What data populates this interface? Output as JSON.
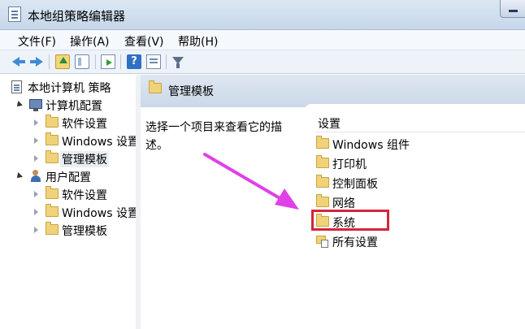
{
  "window": {
    "title": "本地组策略编辑器"
  },
  "menu": [
    {
      "label": "文件(F)"
    },
    {
      "label": "操作(A)"
    },
    {
      "label": "查看(V)"
    },
    {
      "label": "帮助(H)"
    }
  ],
  "toolbar": {
    "icons": [
      "back-icon",
      "forward-icon",
      "up-folder-icon",
      "show-hide-pane-icon",
      "export-list-icon",
      "help-icon",
      "properties-icon",
      "filter-icon"
    ]
  },
  "tree": {
    "root": "本地计算机 策略",
    "computer_config": "计算机配置",
    "computer_children": [
      "软件设置",
      "Windows 设置",
      "管理模板"
    ],
    "user_config": "用户配置",
    "user_children": [
      "软件设置",
      "Windows 设置",
      "管理模板"
    ]
  },
  "content": {
    "header_title": "管理模板",
    "description": "选择一个项目来查看它的描述。",
    "column_header": "设置",
    "items": [
      "Windows 组件",
      "打印机",
      "控制面板",
      "网络",
      "系统",
      "所有设置"
    ]
  },
  "colors": {
    "highlight": "#d3263a",
    "annotation_arrow": "#e040e8"
  }
}
